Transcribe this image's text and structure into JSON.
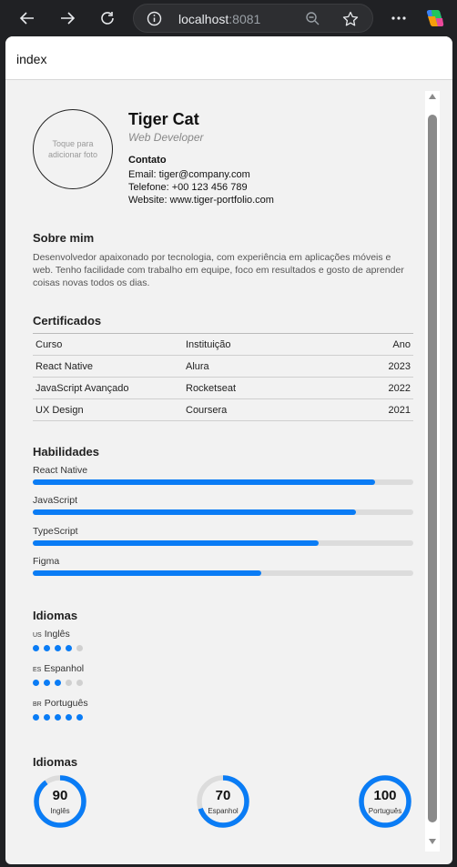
{
  "browser": {
    "address_host": "localhost",
    "address_port": ":8081",
    "tab_title": "index"
  },
  "profile": {
    "avatar_hint": "Toque para adicionar foto",
    "name": "Tiger Cat",
    "role": "Web Developer",
    "contact_title": "Contato",
    "email": "Email: tiger@company.com",
    "phone": "Telefone: +00 123 456 789",
    "website": "Website: www.tiger-portfolio.com"
  },
  "about": {
    "title": "Sobre mim",
    "text": "Desenvolvedor apaixonado por tecnologia, com experiência em aplicações móveis e web. Tenho facilidade com trabalho em equipe, foco em resultados e gosto de aprender coisas novas todos os dias."
  },
  "certificates": {
    "title": "Certificados",
    "headers": [
      "Curso",
      "Instituição",
      "Ano"
    ],
    "rows": [
      [
        "React Native",
        "Alura",
        "2023"
      ],
      [
        "JavaScript Avançado",
        "Rocketseat",
        "2022"
      ],
      [
        "UX Design",
        "Coursera",
        "2021"
      ]
    ]
  },
  "skills": {
    "title": "Habilidades",
    "items": [
      {
        "label": "React Native",
        "level": 0.9
      },
      {
        "label": "JavaScript",
        "level": 0.85
      },
      {
        "label": "TypeScript",
        "level": 0.75
      },
      {
        "label": "Figma",
        "level": 0.6
      }
    ]
  },
  "languages": {
    "title": "Idiomas",
    "items": [
      {
        "code": "US",
        "label": "Inglês",
        "rating": 4,
        "max": 5
      },
      {
        "code": "ES",
        "label": "Espanhol",
        "rating": 3,
        "max": 5
      },
      {
        "code": "BR",
        "label": "Português",
        "rating": 5,
        "max": 5
      }
    ]
  },
  "language_progress": {
    "title": "Idiomas",
    "items": [
      {
        "value": "90",
        "label": "Inglês",
        "percent": 90
      },
      {
        "value": "70",
        "label": "Espanhol",
        "percent": 70
      },
      {
        "value": "100",
        "label": "Português",
        "percent": 100
      }
    ]
  },
  "colors": {
    "accent": "#0a7cf5",
    "track": "#dcdcdc"
  }
}
